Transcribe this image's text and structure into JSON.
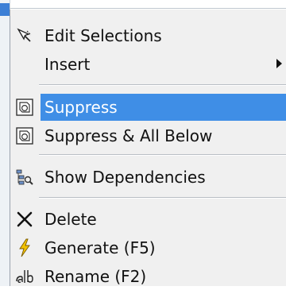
{
  "menu": {
    "items": [
      {
        "label": "Edit Selections",
        "icon": "edit-selections-icon"
      },
      {
        "label": "Insert",
        "icon": "",
        "submenu": true
      },
      {
        "label": "Suppress",
        "icon": "suppress-icon",
        "highlighted": true
      },
      {
        "label": "Suppress & All Below",
        "icon": "suppress-all-below-icon"
      },
      {
        "label": "Show Dependencies",
        "icon": "show-dependencies-icon"
      },
      {
        "label": "Delete",
        "icon": "delete-icon"
      },
      {
        "label": "Generate (F5)",
        "icon": "generate-icon"
      },
      {
        "label": "Rename (F2)",
        "icon": "rename-icon"
      }
    ]
  },
  "colors": {
    "highlight": "#3f8ee6",
    "menu_background": "#f0f0f0",
    "generate_icon": "#f2c200"
  }
}
